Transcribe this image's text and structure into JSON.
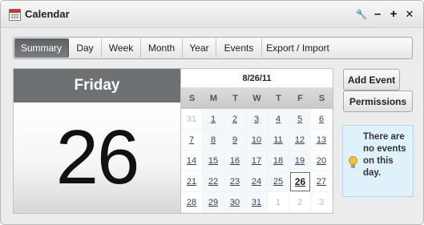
{
  "window": {
    "title": "Calendar"
  },
  "controls": {
    "settings": "🔧",
    "minimize": "–",
    "maximize": "+",
    "close": "✕"
  },
  "tabs": [
    {
      "label": "Summary",
      "active": true
    },
    {
      "label": "Day"
    },
    {
      "label": "Week"
    },
    {
      "label": "Month"
    },
    {
      "label": "Year"
    },
    {
      "label": "Events"
    },
    {
      "label": "Export / Import"
    }
  ],
  "day": {
    "name": "Friday",
    "number": "26"
  },
  "minical": {
    "header": "8/26/11",
    "dow": [
      "S",
      "M",
      "T",
      "W",
      "T",
      "F",
      "S"
    ],
    "weeks": [
      [
        "31",
        "1",
        "2",
        "3",
        "4",
        "5",
        "6"
      ],
      [
        "7",
        "8",
        "9",
        "10",
        "11",
        "12",
        "13"
      ],
      [
        "14",
        "15",
        "16",
        "17",
        "18",
        "19",
        "20"
      ],
      [
        "21",
        "22",
        "23",
        "24",
        "25",
        "26",
        "27"
      ],
      [
        "28",
        "29",
        "30",
        "31",
        "1",
        "2",
        "3"
      ]
    ]
  },
  "actions": {
    "add_event": "Add Event",
    "permissions": "Permissions"
  },
  "notice": {
    "text": "There are no events on this day."
  }
}
